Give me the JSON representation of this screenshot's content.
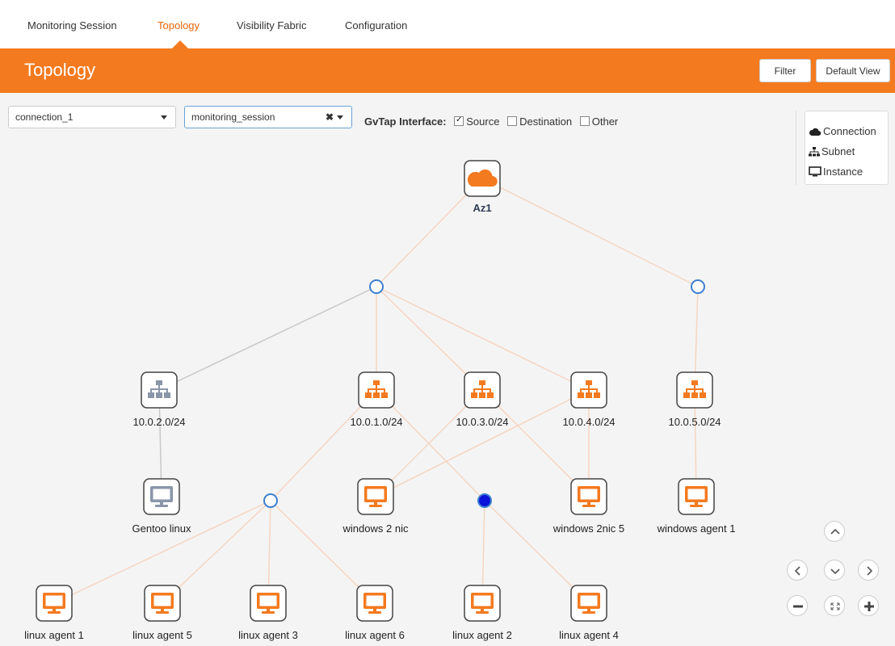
{
  "nav": {
    "tabs": [
      {
        "label": "Monitoring Session",
        "active": false
      },
      {
        "label": "Topology",
        "active": true
      },
      {
        "label": "Visibility Fabric",
        "active": false
      },
      {
        "label": "Configuration",
        "active": false
      }
    ]
  },
  "header": {
    "title": "Topology",
    "filter_label": "Filter",
    "default_view_label": "Default View"
  },
  "toolbar": {
    "connection_value": "connection_1",
    "session_value": "monitoring_session",
    "gvtap_label": "GvTap Interface:",
    "checkboxes": [
      {
        "label": "Source",
        "checked": true
      },
      {
        "label": "Destination",
        "checked": false
      },
      {
        "label": "Other",
        "checked": false
      }
    ]
  },
  "legend": {
    "items": [
      {
        "label": "Connection",
        "icon": "cloud-icon"
      },
      {
        "label": "Subnet",
        "icon": "sitemap-icon"
      },
      {
        "label": "Instance",
        "icon": "monitor-icon"
      }
    ]
  },
  "colors": {
    "accent": "#f47a1f",
    "inactive_icon": "#8a96a8",
    "selected_node": "#0a14d8",
    "edge": "#f5d5c2",
    "edge_inactive": "#c8c8c8"
  },
  "topology": {
    "connection": {
      "label": "Az1"
    },
    "subnets": [
      "10.0.2.0/24",
      "10.0.1.0/24",
      "10.0.3.0/24",
      "10.0.4.0/24",
      "10.0.5.0/24"
    ],
    "instances": [
      "Gentoo linux",
      "windows 2 nic",
      "windows 2nic 5",
      "windows agent 1",
      "linux agent 1",
      "linux agent 5",
      "linux agent 3",
      "linux agent 6",
      "linux agent 2",
      "linux agent 4"
    ]
  },
  "controls": [
    "pan-up-button",
    "pan-left-button",
    "pan-down-button",
    "pan-right-button",
    "zoom-out-button",
    "fit-view-button",
    "zoom-in-button"
  ]
}
